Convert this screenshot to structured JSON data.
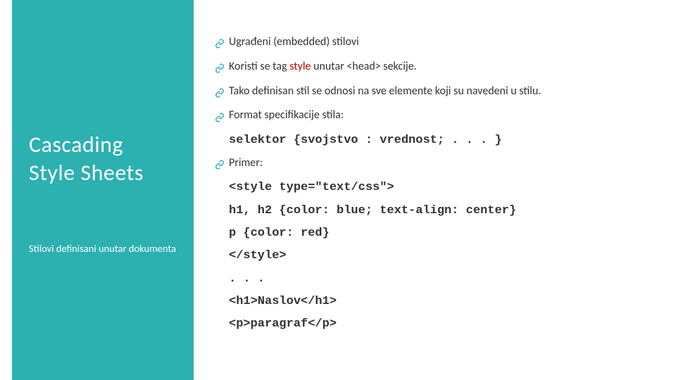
{
  "sidebar": {
    "title_line1": "Cascading",
    "title_line2": "Style Sheets",
    "subtitle": "Stilovi definisani unutar dokumenta"
  },
  "bullets": {
    "b1": "Ugrađeni (embedded) stilovi",
    "b2_pre": "Koristi se tag ",
    "b2_red": "style",
    "b2_post": " unutar <head> sekcije.",
    "b3": "Tako definisan stil se odnosi na sve elemente koji su navedeni u stilu.",
    "b4": "Format specifikacije stila:",
    "b5": "Primer:"
  },
  "code": {
    "c1": "selektor {svojstvo : vrednost; . . . }",
    "c2": "<style type=\"text/css\">",
    "c3": "h1, h2 {color: blue; text-align: center}",
    "c4": "p {color: red}",
    "c5": "</style>",
    "c6": ". . .",
    "c7": "<h1>Naslov</h1>",
    "c8": "<p>paragraf</p>"
  }
}
